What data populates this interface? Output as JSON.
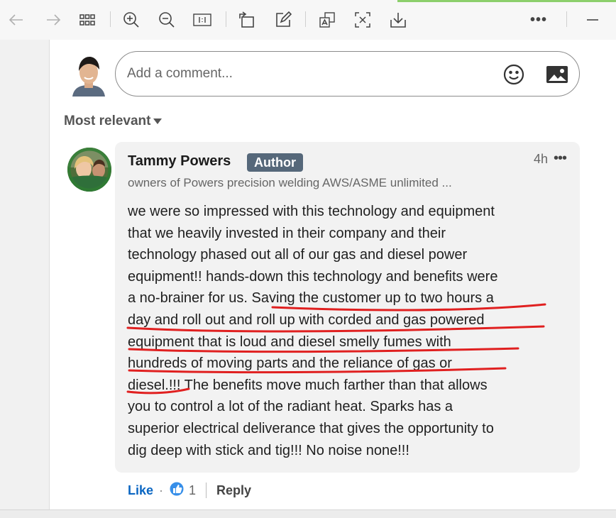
{
  "comment_box": {
    "placeholder": "Add a comment..."
  },
  "sort": {
    "label": "Most relevant"
  },
  "comment": {
    "author": "Tammy Powers",
    "badge": "Author",
    "time": "4h",
    "more": "•••",
    "headline": "owners of Powers precision welding AWS/ASME unlimited ...",
    "lines": [
      "we were so impressed with this technology and equipment",
      "that we heavily invested in their company and their",
      "technology phased out all of our gas and diesel power",
      "equipment!! hands-down this technology and benefits were",
      "a no-brainer for us. Saving the customer up to two hours a",
      "day and roll out and roll up with corded and gas powered",
      "equipment that is loud and diesel smelly fumes with",
      "hundreds of moving parts and the reliance of gas or",
      "diesel.!!! The benefits move much farther than that allows",
      "you to control a lot of the radiant heat. Sparks has a",
      "superior electrical deliverance that gives the opportunity to",
      "dig deep with stick and tig!!! No noise none!!!"
    ],
    "actions": {
      "like": "Like",
      "dot": "·",
      "reaction_count": "1",
      "reply": "Reply"
    }
  },
  "colors": {
    "like_blue": "#0a66c2",
    "badge_bg": "#56687a",
    "annotation_red": "#e02020",
    "toolbar_accent": "#8ccf6b"
  },
  "toolbar_icons": [
    "back-arrow-icon",
    "forward-arrow-icon",
    "grid-view-icon",
    "zoom-in-icon",
    "zoom-out-icon",
    "actual-size-icon",
    "rotate-icon",
    "edit-icon",
    "translate-icon",
    "ocr-icon",
    "download-icon",
    "more-icon",
    "minimize-icon"
  ]
}
